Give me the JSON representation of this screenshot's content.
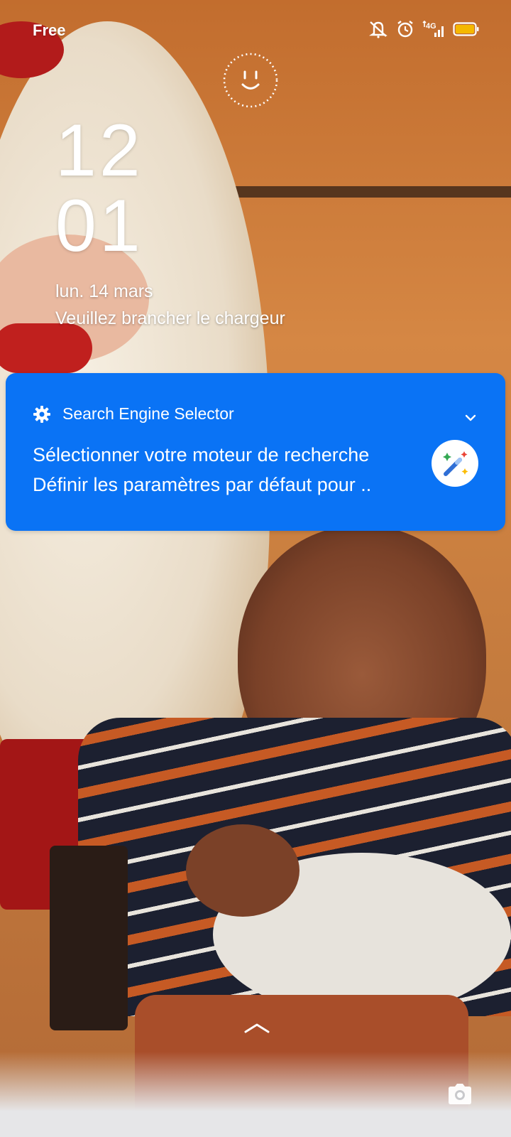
{
  "status_bar": {
    "carrier": "Free",
    "network": "4G",
    "icons": [
      "mute-icon",
      "alarm-icon",
      "signal-icon",
      "battery-icon"
    ],
    "battery_color": "#f5b800"
  },
  "lock_screen": {
    "clock_hour": "12",
    "clock_minute": "01",
    "date": "lun. 14 mars",
    "charger_message": "Veuillez brancher le chargeur"
  },
  "notification": {
    "app_name": "Search Engine Selector",
    "title": "Sélectionner votre moteur de recherche",
    "text": "Définir les paramètres par défaut pour ..",
    "background": "#0a73f5",
    "app_icon": "magic-wand-icon"
  }
}
